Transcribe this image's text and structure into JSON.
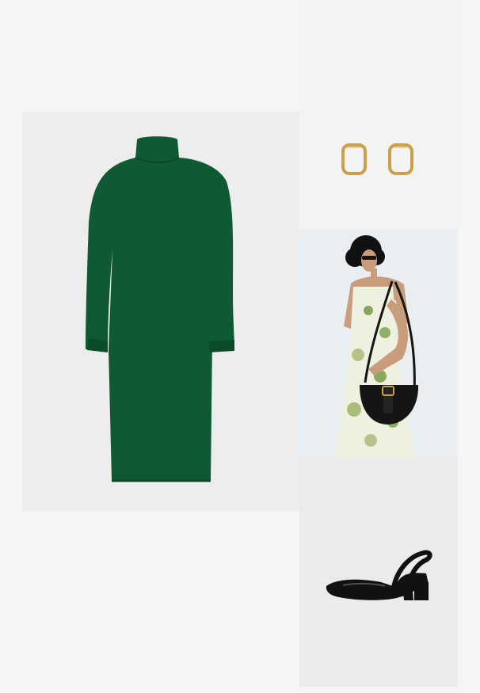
{
  "colors": {
    "page_background": "#f5f5f5",
    "dress_green": "#0f5a32",
    "earring_gold": "#caa14a",
    "bag_black": "#151515",
    "shoe_black": "#111111"
  },
  "icons": [
    "dress-image",
    "earrings-image",
    "model-with-bag-image",
    "slingback-shoe-image"
  ]
}
